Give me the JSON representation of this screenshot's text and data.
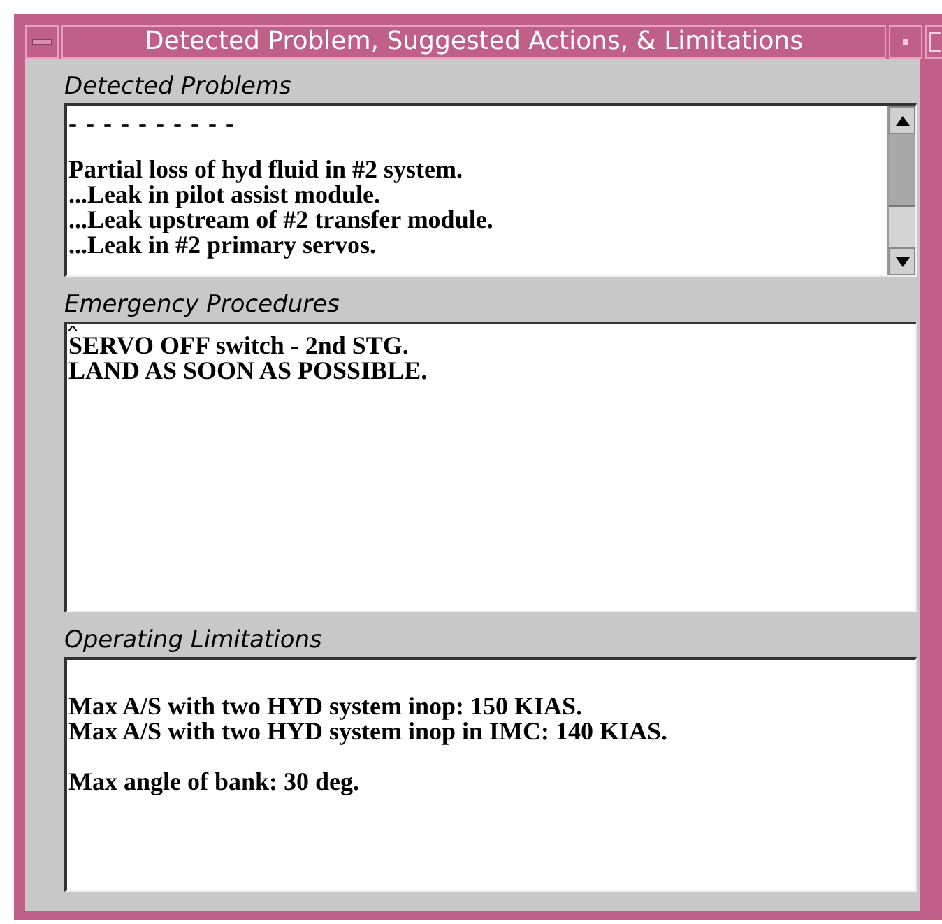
{
  "window": {
    "title": "Detected Problem, Suggested Actions, & Limitations"
  },
  "sections": [
    {
      "label": "Detected Problems",
      "scrollbar": true,
      "cursor": false,
      "lines": [
        {
          "text": "- - - - - - - - - -",
          "kind": "rule"
        },
        {
          "kind": "blank"
        },
        {
          "text": "Partial loss of hyd fluid in #2 system.",
          "kind": "text"
        },
        {
          "text": "...Leak in pilot assist module.",
          "kind": "text"
        },
        {
          "text": "...Leak upstream of #2 transfer module.",
          "kind": "text"
        },
        {
          "text": "...Leak in #2 primary servos.",
          "kind": "text"
        }
      ]
    },
    {
      "label": "Emergency Procedures",
      "scrollbar": false,
      "cursor": true,
      "lines": [
        {
          "text": "SERVO OFF switch - 2nd STG.",
          "kind": "text"
        },
        {
          "text": "LAND AS SOON AS POSSIBLE.",
          "kind": "text"
        }
      ]
    },
    {
      "label": "Operating Limitations",
      "scrollbar": false,
      "cursor": false,
      "lines": [
        {
          "kind": "blank"
        },
        {
          "text": "Max A/S with two HYD system inop: 150 KIAS.",
          "kind": "text"
        },
        {
          "text": "Max A/S with two HYD system inop in IMC: 140 KIAS.",
          "kind": "text"
        },
        {
          "kind": "blank"
        },
        {
          "text": "Max angle of bank: 30 deg.",
          "kind": "text"
        }
      ]
    }
  ]
}
